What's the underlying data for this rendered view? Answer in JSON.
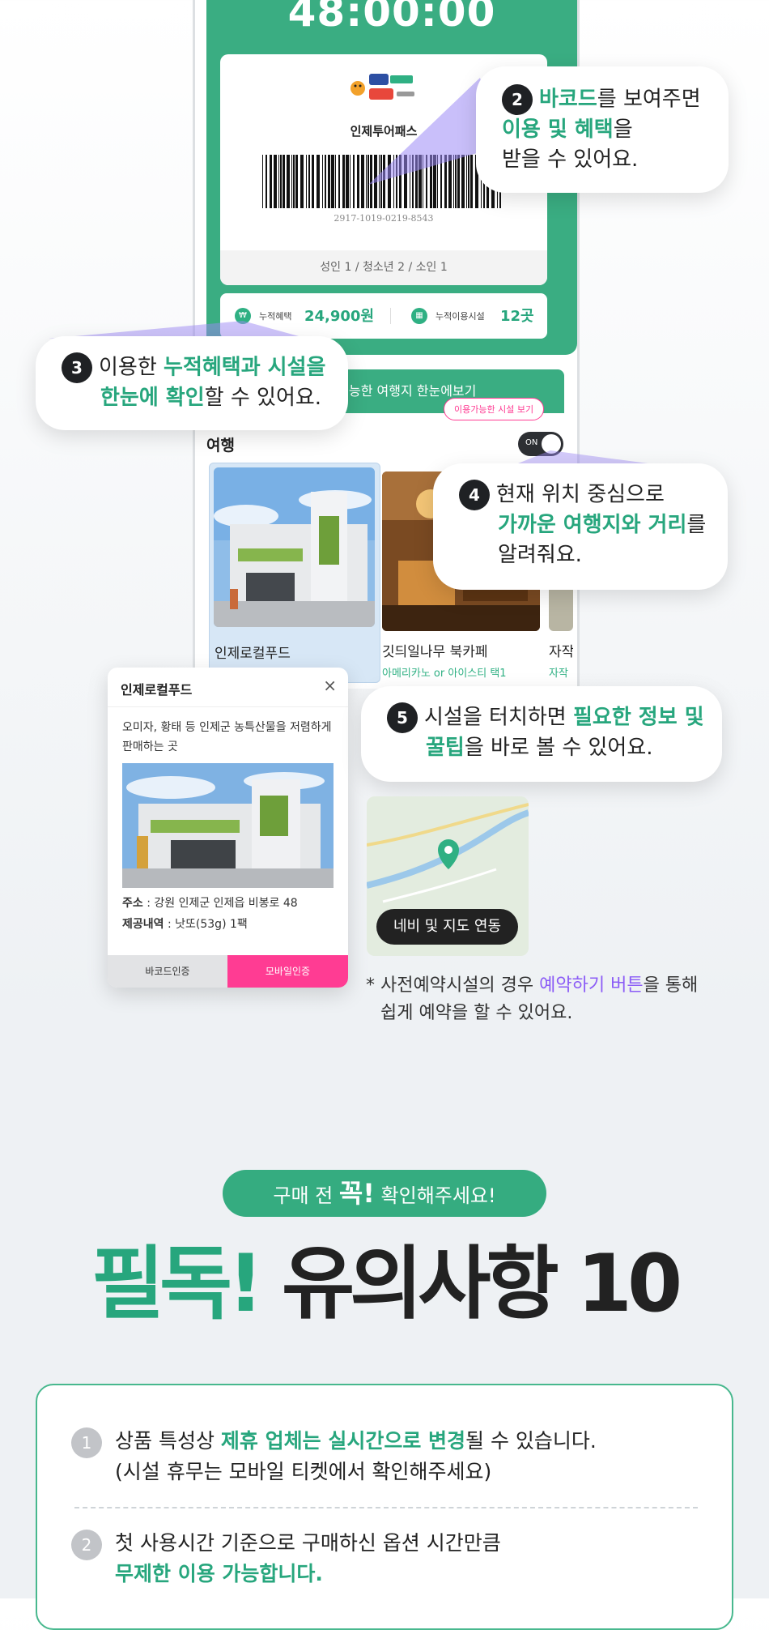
{
  "phone": {
    "timer": "48:00:00",
    "ticket": {
      "logo_text": "인제투어패스",
      "name": "인제투어패스",
      "barcode_number": "2917-1019-0219-8543",
      "counts": "성인 1 / 청소년 2 / 소인 1"
    },
    "stats": {
      "benefit_label": "누적혜택",
      "benefit_value": "24,900원",
      "facility_label": "누적이용시설",
      "facility_value": "12곳"
    },
    "green_bar_text": "능한 여행지 한눈에보기",
    "section_title": "여행",
    "toggle_tip": "이용가능한 시설 보기",
    "toggle_label": "ON",
    "cards": [
      {
        "title": "인제로컬푸드",
        "sub": ""
      },
      {
        "title": "깃듸일나무 북카페",
        "sub": "아메리카노 or 아이스티 택1"
      },
      {
        "title": "자작",
        "sub": "자작"
      }
    ]
  },
  "callouts": {
    "c2": {
      "num": "2",
      "hl1": "바코드",
      "t1": "를 보여주면",
      "hl2": "이용 및 혜택",
      "t2": "을",
      "t3": "받을 수 있어요."
    },
    "c3": {
      "num": "3",
      "t1": "이용한 ",
      "hl1": "누적혜택과 시설을",
      "hl2": "한눈에 확인",
      "t2": "할 수 있어요."
    },
    "c4": {
      "num": "4",
      "t1": "현재 위치 중심으로",
      "hl1": "가까운 여행지와 거리",
      "t2": "를",
      "t3": "알려줘요."
    },
    "c5": {
      "num": "5",
      "t1": "시설을 터치하면 ",
      "hl1": "필요한 정보 및",
      "hl2": "꿀팁",
      "t2": "을 바로 볼 수 있어요."
    }
  },
  "popup": {
    "title": "인제로컬푸드",
    "close": "×",
    "desc": "오미자, 황태 등 인제군 농특산물을 저렴하게 판매하는 곳",
    "addr_label": "주소",
    "addr_value": " : 강원 인제군 인제읍 비봉로 48",
    "provide_label": "제공내역",
    "provide_value": " : 낫또(53g) 1팩",
    "btn_barcode": "바코드인증",
    "btn_mobile": "모바일인증"
  },
  "map": {
    "button": "네비 및 지도 연동"
  },
  "note": {
    "t1": "* 사전예약시설의 경우 ",
    "hl": "예약하기 버튼",
    "t2": "을 통해",
    "t3": "쉽게 예약을 할 수 있어요."
  },
  "notice": {
    "pill_t1": "구매 전 ",
    "pill_hl": "꼭!",
    "pill_t2": " 확인해주세요!",
    "head_hl": "필독!",
    "head_t": " 유의사항 10",
    "items": [
      {
        "num": "1",
        "t1": "상품 특성상 ",
        "hl": "제휴 업체는 실시간으로 변경",
        "t2": "될 수 있습니다.",
        "t3": "(시설 휴무는 모바일 티켓에서 확인해주세요)"
      },
      {
        "num": "2",
        "t1": "첫 사용시간 기준으로 구매하신 옵션 시간만큼",
        "hl": "무제한 이용 가능합니다."
      }
    ]
  },
  "colors": {
    "accent": "#3aad82",
    "highlight_purple": "#8b5cf6",
    "pink": "#ff3c93"
  }
}
